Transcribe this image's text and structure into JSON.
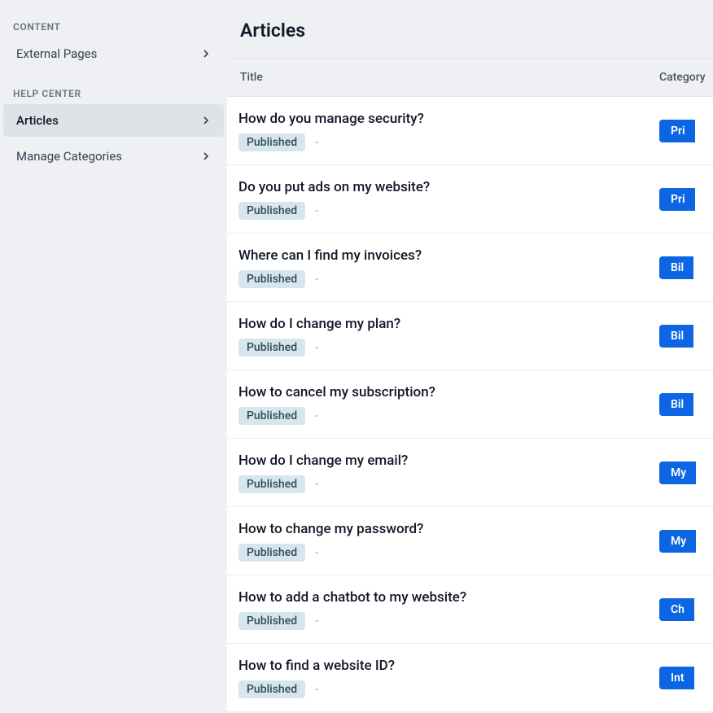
{
  "sidebar": {
    "sections": [
      {
        "label": "CONTENT",
        "items": [
          {
            "id": "external-pages",
            "label": "External Pages",
            "active": false
          }
        ]
      },
      {
        "label": "HELP CENTER",
        "items": [
          {
            "id": "articles",
            "label": "Articles",
            "active": true
          },
          {
            "id": "manage-categories",
            "label": "Manage Categories",
            "active": false
          }
        ]
      }
    ]
  },
  "header": {
    "title": "Articles"
  },
  "table": {
    "columns": {
      "title": "Title",
      "category": "Category"
    }
  },
  "articles": [
    {
      "title": "How do you manage security?",
      "status": "Published",
      "extra": "-",
      "category_visible": "Pri"
    },
    {
      "title": "Do you put ads on my website?",
      "status": "Published",
      "extra": "-",
      "category_visible": "Pri"
    },
    {
      "title": "Where can I find my invoices?",
      "status": "Published",
      "extra": "-",
      "category_visible": "Bil"
    },
    {
      "title": "How do I change my plan?",
      "status": "Published",
      "extra": "-",
      "category_visible": "Bil"
    },
    {
      "title": "How to cancel my subscription?",
      "status": "Published",
      "extra": "-",
      "category_visible": "Bil"
    },
    {
      "title": "How do I change my email?",
      "status": "Published",
      "extra": "-",
      "category_visible": "My"
    },
    {
      "title": "How to change my password?",
      "status": "Published",
      "extra": "-",
      "category_visible": "My"
    },
    {
      "title": "How to add a chatbot to my website?",
      "status": "Published",
      "extra": "-",
      "category_visible": "Ch"
    },
    {
      "title": "How to find a website ID?",
      "status": "Published",
      "extra": "-",
      "category_visible": "Int"
    }
  ]
}
